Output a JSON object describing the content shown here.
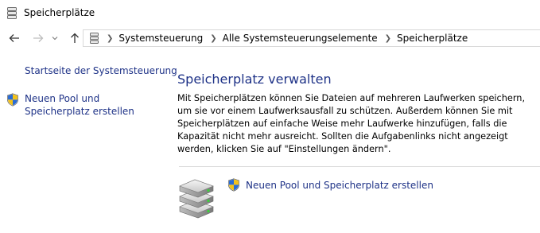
{
  "window": {
    "title": "Speicherplätze",
    "icon": "storage-spaces-icon"
  },
  "navigation": {
    "back_icon": "back-arrow-icon",
    "forward_icon": "forward-arrow-icon",
    "recent_icon": "chevron-down-icon",
    "up_icon": "up-arrow-icon"
  },
  "address_bar": {
    "icon": "storage-spaces-icon",
    "breadcrumbs": [
      "Systemsteuerung",
      "Alle Systemsteuerungselemente",
      "Speicherplätze"
    ]
  },
  "sidebar": {
    "home_link": "Startseite der Systemsteuerung",
    "tasks": [
      {
        "label": "Neuen Pool und Speicherplatz erstellen",
        "icon": "uac-shield-icon"
      }
    ]
  },
  "main": {
    "heading": "Speicherplatz verwalten",
    "description": "Mit Speicherplätzen können Sie Dateien auf mehreren Laufwerken speichern, um sie vor einem Laufwerksausfall zu schützen. Außerdem können Sie mit Speicherplätzen auf einfache Weise mehr Laufwerke hinzufügen, falls die Kapazität nicht mehr ausreicht. Sollten die Aufgabenlinks nicht angezeigt werden, klicken Sie auf \"Einstellungen ändern\".",
    "create_link": "Neuen Pool und Speicherplatz erstellen",
    "create_icon": "uac-shield-icon",
    "illustration": "drive-stack-icon"
  },
  "colors": {
    "link": "#1e3287",
    "heading": "#1e3287",
    "divider": "#dadada"
  }
}
